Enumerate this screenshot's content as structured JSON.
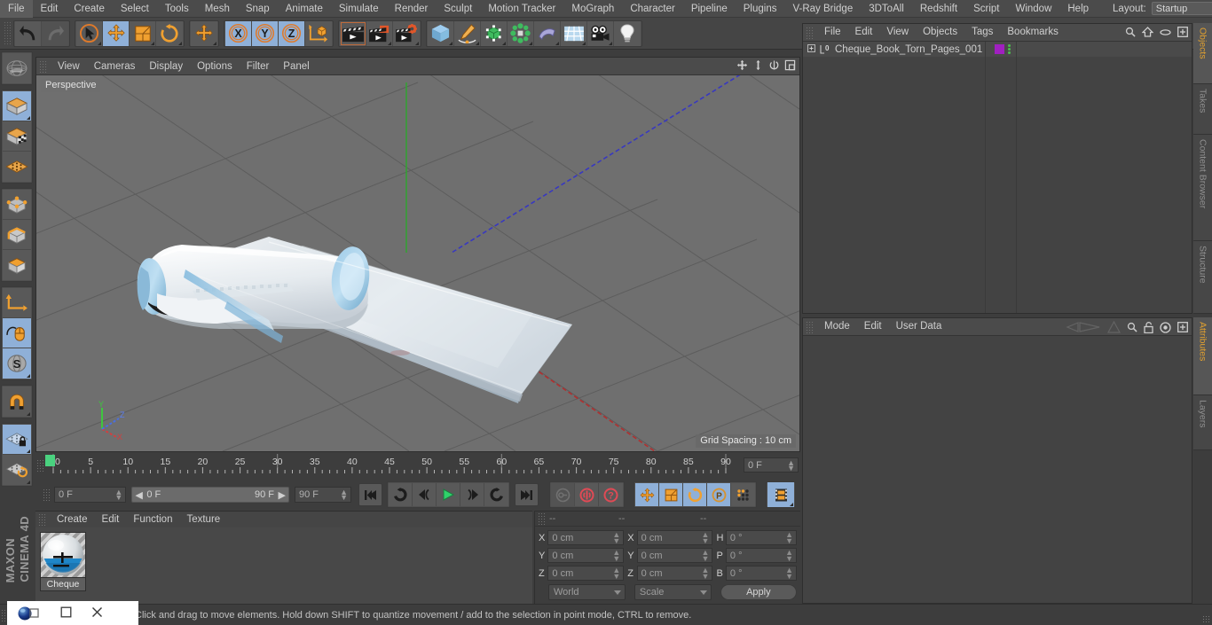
{
  "app": {
    "title": "CINEMA 4D",
    "brand": "MAXON"
  },
  "menubar": {
    "items": [
      {
        "label": "File"
      },
      {
        "label": "Edit"
      },
      {
        "label": "Create"
      },
      {
        "label": "Select"
      },
      {
        "label": "Tools"
      },
      {
        "label": "Mesh"
      },
      {
        "label": "Snap"
      },
      {
        "label": "Animate"
      },
      {
        "label": "Simulate"
      },
      {
        "label": "Render"
      },
      {
        "label": "Sculpt"
      },
      {
        "label": "Motion Tracker"
      },
      {
        "label": "MoGraph"
      },
      {
        "label": "Character"
      },
      {
        "label": "Pipeline"
      },
      {
        "label": "Plugins"
      },
      {
        "label": "V-Ray Bridge"
      },
      {
        "label": "3DToAll"
      },
      {
        "label": "Redshift"
      },
      {
        "label": "Script"
      },
      {
        "label": "Window"
      },
      {
        "label": "Help"
      }
    ],
    "layout_label": "Layout:",
    "layout_value": "Startup",
    "search_icon": "search-icon"
  },
  "toolbar": {
    "groups": [
      {
        "name": "history",
        "buttons": [
          {
            "name": "undo-button",
            "icon": "undo-icon",
            "state": "normal"
          },
          {
            "name": "redo-button",
            "icon": "redo-icon",
            "state": "disabled"
          }
        ]
      },
      {
        "name": "transform",
        "buttons": [
          {
            "name": "live-selection-button",
            "icon": "cursor-circle-icon",
            "state": "normal"
          },
          {
            "name": "move-button",
            "icon": "move-arrows-icon",
            "state": "active"
          },
          {
            "name": "scale-button",
            "icon": "scale-box-icon",
            "state": "normal"
          },
          {
            "name": "rotate-button",
            "icon": "rotate-icon",
            "state": "normal"
          }
        ]
      },
      {
        "name": "world-move",
        "buttons": [
          {
            "name": "move-world-button",
            "icon": "move-arrows-icon",
            "state": "normal"
          }
        ]
      },
      {
        "name": "axis-locks",
        "buttons": [
          {
            "name": "lock-x-button",
            "icon": "axis-x-icon",
            "state": "active"
          },
          {
            "name": "lock-y-button",
            "icon": "axis-y-icon",
            "state": "active"
          },
          {
            "name": "lock-z-button",
            "icon": "axis-z-icon",
            "state": "active"
          },
          {
            "name": "world-object-coord-button",
            "icon": "world-coord-icon",
            "state": "normal"
          }
        ]
      },
      {
        "name": "render",
        "buttons": [
          {
            "name": "render-view-button",
            "icon": "clapperboard-icon",
            "state": "selected"
          },
          {
            "name": "render-region-button",
            "icon": "clapperboard-region-icon",
            "state": "normal"
          },
          {
            "name": "render-settings-button",
            "icon": "clapperboard-gear-icon",
            "state": "normal"
          }
        ]
      },
      {
        "name": "objects",
        "buttons": [
          {
            "name": "add-cube-button",
            "icon": "cube-icon",
            "state": "normal"
          },
          {
            "name": "add-spline-button",
            "icon": "pen-spline-icon",
            "state": "normal"
          },
          {
            "name": "add-nurbs-button",
            "icon": "green-cube-nurbs-icon",
            "state": "normal"
          },
          {
            "name": "add-array-button",
            "icon": "array-icon",
            "state": "normal"
          },
          {
            "name": "add-deformer-button",
            "icon": "bend-deformer-icon",
            "state": "normal"
          },
          {
            "name": "add-environment-button",
            "icon": "floor-environment-icon",
            "state": "normal"
          },
          {
            "name": "add-camera-button",
            "icon": "camera-icon",
            "state": "normal"
          },
          {
            "name": "add-light-button",
            "icon": "light-bulb-icon",
            "state": "normal"
          }
        ]
      }
    ]
  },
  "leftbar": {
    "groups": [
      {
        "buttons": [
          {
            "name": "undo-view-button",
            "icon": "globe-wire-icon",
            "state": "normal"
          }
        ]
      },
      {
        "buttons": [
          {
            "name": "model-mode-button",
            "icon": "model-cube-icon",
            "state": "active"
          },
          {
            "name": "texture-mode-button",
            "icon": "texture-cube-icon",
            "state": "normal"
          },
          {
            "name": "workplane-mode-button",
            "icon": "workplane-icon",
            "state": "normal"
          }
        ]
      },
      {
        "buttons": [
          {
            "name": "points-mode-button",
            "icon": "points-cube-icon",
            "state": "normal"
          },
          {
            "name": "edges-mode-button",
            "icon": "edges-cube-icon",
            "state": "normal"
          },
          {
            "name": "polygons-mode-button",
            "icon": "polygons-cube-icon",
            "state": "normal"
          }
        ]
      },
      {
        "buttons": [
          {
            "name": "axis-mode-button",
            "icon": "axis-corner-icon",
            "state": "normal"
          },
          {
            "name": "enable-axis-button",
            "icon": "mouse-axis-icon",
            "state": "active"
          },
          {
            "name": "soft-selection-button",
            "icon": "s-sphere-icon",
            "state": "active"
          }
        ]
      },
      {
        "buttons": [
          {
            "name": "magnet-button",
            "icon": "magnet-icon",
            "state": "normal"
          }
        ]
      },
      {
        "buttons": [
          {
            "name": "lock-workplane-button",
            "icon": "grid-lock-icon",
            "state": "active"
          },
          {
            "name": "planar-workplane-button",
            "icon": "grid-rotate-icon",
            "state": "normal"
          }
        ]
      }
    ]
  },
  "viewport": {
    "menu": [
      {
        "label": "View"
      },
      {
        "label": "Cameras"
      },
      {
        "label": "Display"
      },
      {
        "label": "Options"
      },
      {
        "label": "Filter"
      },
      {
        "label": "Panel"
      }
    ],
    "label": "Perspective",
    "grid_spacing": "Grid Spacing : 10 cm",
    "header_icons": [
      {
        "name": "viewport-pan-icon"
      },
      {
        "name": "viewport-dolly-icon"
      },
      {
        "name": "viewport-rotate-icon"
      },
      {
        "name": "viewport-maximize-icon"
      }
    ],
    "axis_gizmo": {
      "x": "X",
      "y": "Y",
      "z": "Z"
    },
    "colors": {
      "background": "#6f6f6f",
      "grid_line": "#5b5b5b",
      "axis_x": "#b03030",
      "axis_y": "#35a035",
      "axis_z": "#3838c0"
    }
  },
  "timeline": {
    "ticks": [
      "0",
      "5",
      "10",
      "15",
      "20",
      "25",
      "30",
      "35",
      "40",
      "45",
      "50",
      "55",
      "60",
      "65",
      "70",
      "75",
      "80",
      "85",
      "90"
    ],
    "range_start": 0,
    "range_end": 90,
    "current_frame_label": "0 F",
    "playhead_frame": 0
  },
  "animbar": {
    "current_frame": "0 F",
    "preview_start": "0 F",
    "preview_end": "90 F",
    "max_frame": "90 F",
    "buttons": [
      {
        "name": "go-to-start-button",
        "icon": "skip-start-icon",
        "state": "normal"
      },
      {
        "name": "play-reverse-loop-button",
        "icon": "loop-reverse-icon",
        "state": "normal"
      },
      {
        "name": "step-back-button",
        "icon": "step-back-icon",
        "state": "normal"
      },
      {
        "name": "play-button",
        "icon": "play-icon",
        "state": "normal"
      },
      {
        "name": "step-forward-button",
        "icon": "step-forward-icon",
        "state": "normal"
      },
      {
        "name": "loop-forward-button",
        "icon": "loop-forward-icon",
        "state": "normal"
      },
      {
        "name": "go-to-end-button",
        "icon": "skip-end-icon",
        "state": "normal"
      },
      {
        "name": "record-keyframe-button",
        "icon": "key-icon",
        "state": "disabled"
      },
      {
        "name": "autokey-button",
        "icon": "autokey-circle-icon",
        "state": "normal"
      },
      {
        "name": "keyframe-selection-button",
        "icon": "question-circle-icon",
        "state": "normal"
      },
      {
        "name": "record-position-button",
        "icon": "move-arrows-icon",
        "state": "active"
      },
      {
        "name": "record-scale-button",
        "icon": "scale-box-icon",
        "state": "active"
      },
      {
        "name": "record-rotation-button",
        "icon": "rotate-icon",
        "state": "active"
      },
      {
        "name": "record-param-button",
        "icon": "p-circle-icon",
        "state": "active"
      },
      {
        "name": "record-points-button",
        "icon": "dots-grid-icon",
        "state": "normal"
      },
      {
        "name": "timeline-toggle-button",
        "icon": "filmstrip-icon",
        "state": "active"
      }
    ]
  },
  "material_manager": {
    "menu": [
      {
        "label": "Create"
      },
      {
        "label": "Edit"
      },
      {
        "label": "Function"
      },
      {
        "label": "Texture"
      }
    ],
    "materials": [
      {
        "name": "Cheque",
        "color": "#2f86c8"
      }
    ]
  },
  "coordinates": {
    "headers": [
      "--",
      "--",
      "--"
    ],
    "rows": [
      {
        "pos_label": "X",
        "pos_value": "0 cm",
        "size_label": "X",
        "size_value": "0 cm",
        "rot_label": "H",
        "rot_value": "0 °"
      },
      {
        "pos_label": "Y",
        "pos_value": "0 cm",
        "size_label": "Y",
        "size_value": "0 cm",
        "rot_label": "P",
        "rot_value": "0 °"
      },
      {
        "pos_label": "Z",
        "pos_value": "0 cm",
        "size_label": "Z",
        "size_value": "0 cm",
        "rot_label": "B",
        "rot_value": "0 °"
      }
    ],
    "coord_system": "World",
    "size_mode": "Scale",
    "apply_label": "Apply"
  },
  "object_manager": {
    "menu": [
      {
        "label": "File"
      },
      {
        "label": "Edit"
      },
      {
        "label": "View"
      },
      {
        "label": "Objects"
      },
      {
        "label": "Tags"
      },
      {
        "label": "Bookmarks"
      }
    ],
    "header_icons": [
      {
        "name": "search-icon"
      },
      {
        "name": "home-icon"
      },
      {
        "name": "ellipse-icon"
      },
      {
        "name": "add-panel-icon"
      }
    ],
    "objects": [
      {
        "name": "Cheque_Book_Torn_Pages_001",
        "expand_icon": "expand-plus-icon",
        "layer_badge": "0",
        "tag_color": "#a020c0",
        "has_tags": true
      }
    ]
  },
  "attribute_manager": {
    "menu": [
      {
        "label": "Mode"
      },
      {
        "label": "Edit"
      },
      {
        "label": "User Data"
      }
    ],
    "header_icons": [
      {
        "name": "nav-back-icon"
      },
      {
        "name": "nav-up-icon"
      },
      {
        "name": "search-icon"
      },
      {
        "name": "lock-icon"
      },
      {
        "name": "target-icon"
      },
      {
        "name": "add-panel-icon"
      }
    ]
  },
  "right_tabs_top": [
    {
      "label": "Objects",
      "active": true
    },
    {
      "label": "Takes",
      "active": false
    },
    {
      "label": "Content Browser",
      "active": false
    },
    {
      "label": "Structure",
      "active": false
    }
  ],
  "right_tabs_bottom": [
    {
      "label": "Attributes",
      "active": true
    },
    {
      "label": "Layers",
      "active": false
    }
  ],
  "statusbar": {
    "message": "Click and drag to move elements. Hold down SHIFT to quantize movement / add to the selection in point mode, CTRL to remove."
  },
  "taskbar": {
    "items": [
      {
        "name": "c4d-app-icon"
      },
      {
        "name": "window-restore-icon"
      },
      {
        "name": "window-close-icon"
      }
    ]
  }
}
